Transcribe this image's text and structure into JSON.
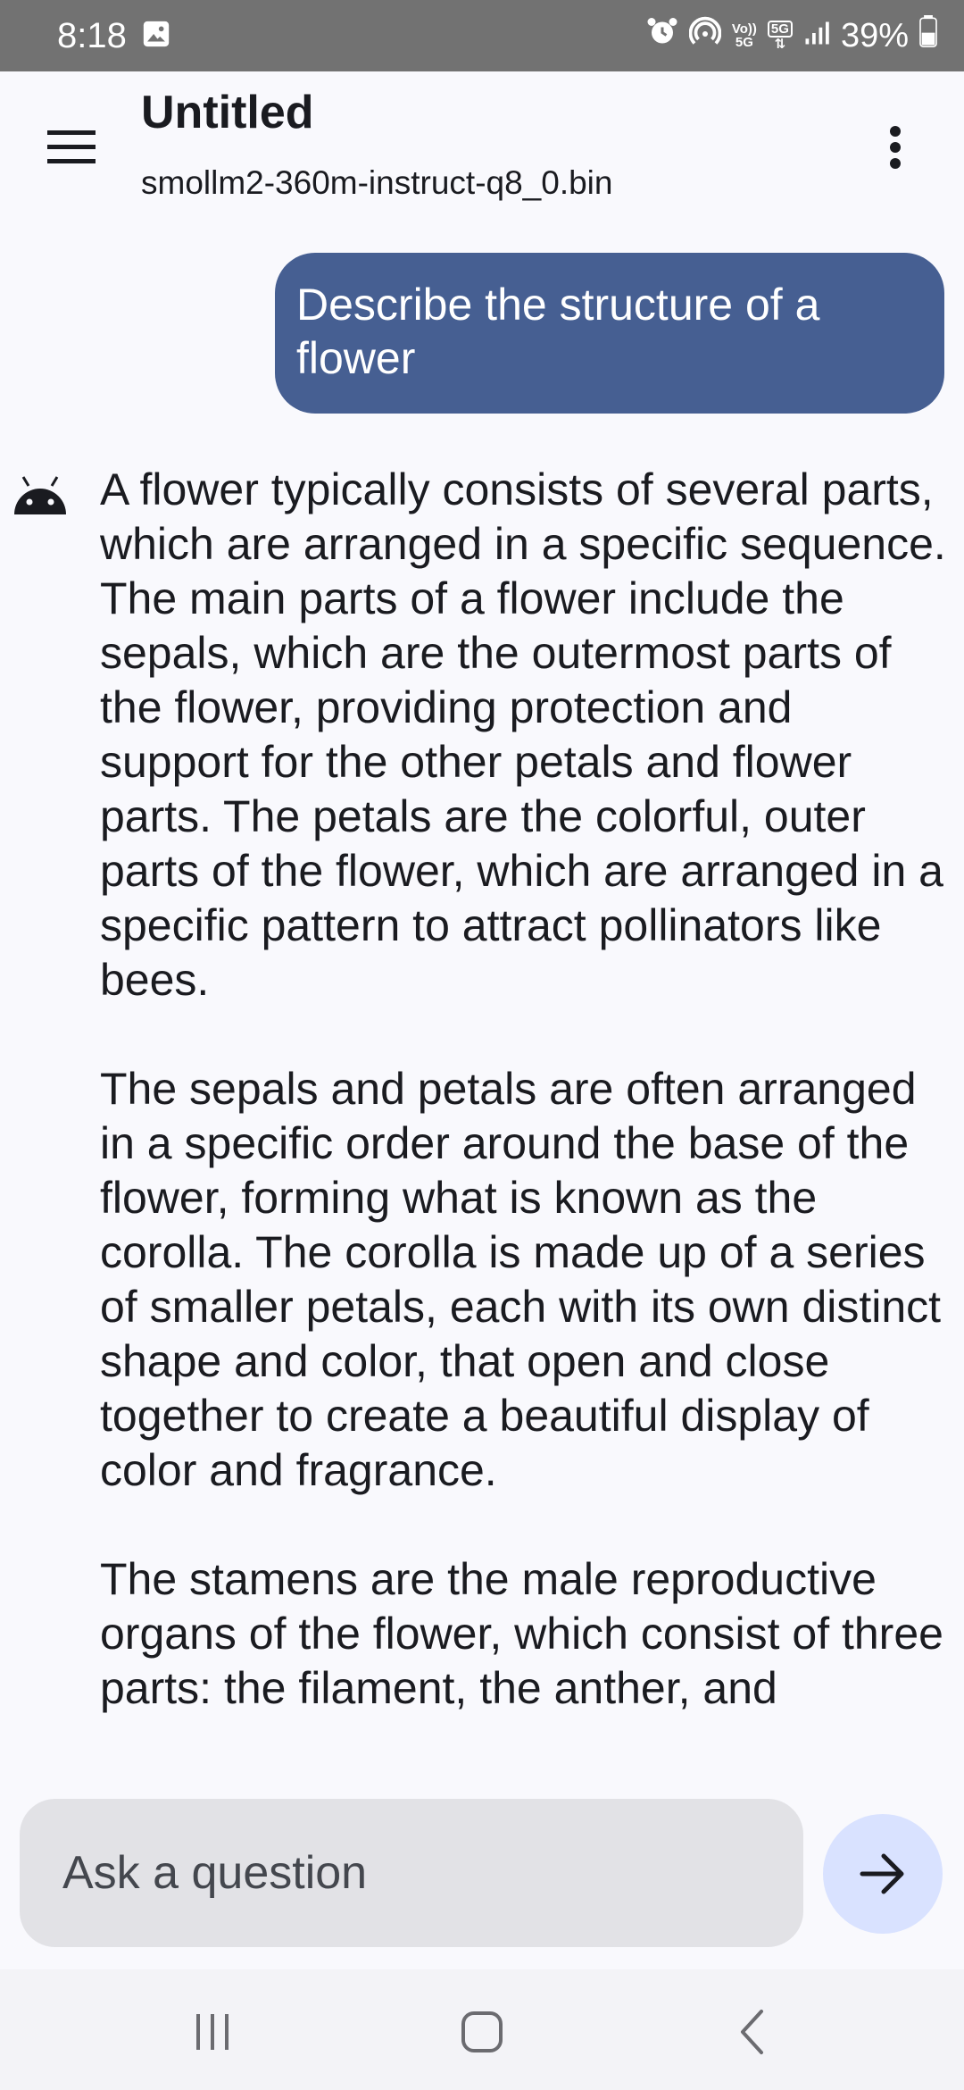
{
  "status_bar": {
    "time": "8:18",
    "net_top": "Vo))",
    "net_bottom": "5G",
    "network": "5G",
    "battery": "39%"
  },
  "app_bar": {
    "title": "Untitled",
    "model": "smollm2-360m-instruct-q8_0.bin"
  },
  "chat": {
    "user_message": "Describe the structure of a flower",
    "assistant_paragraphs": [
      "A flower typically consists of several parts, which are arranged in a specific sequence. The main parts of a flower include the sepals, which are the outermost parts of the flower, providing protection and support for the other petals and flower parts. The petals are the colorful, outer parts of the flower, which are arranged in a specific pattern to attract pollinators like bees.",
      "The sepals and petals are often arranged in a specific order around the base of the flower, forming what is known as the corolla. The corolla is made up of a series of smaller petals, each with its own distinct shape and color, that open and close together to create a beautiful display of color and fragrance.",
      "The stamens are the male reproductive organs of the flower, which consist of three parts: the filament, the anther, and"
    ]
  },
  "input": {
    "placeholder": "Ask a question"
  },
  "colors": {
    "accent": "#465f92",
    "send_button_bg": "#d9e2ff",
    "status_bar_bg": "#727272"
  },
  "icons": {
    "menu": "hamburger-menu-icon",
    "overflow": "more-vert-icon",
    "assistant": "android-robot-icon",
    "send": "arrow-right-icon"
  }
}
